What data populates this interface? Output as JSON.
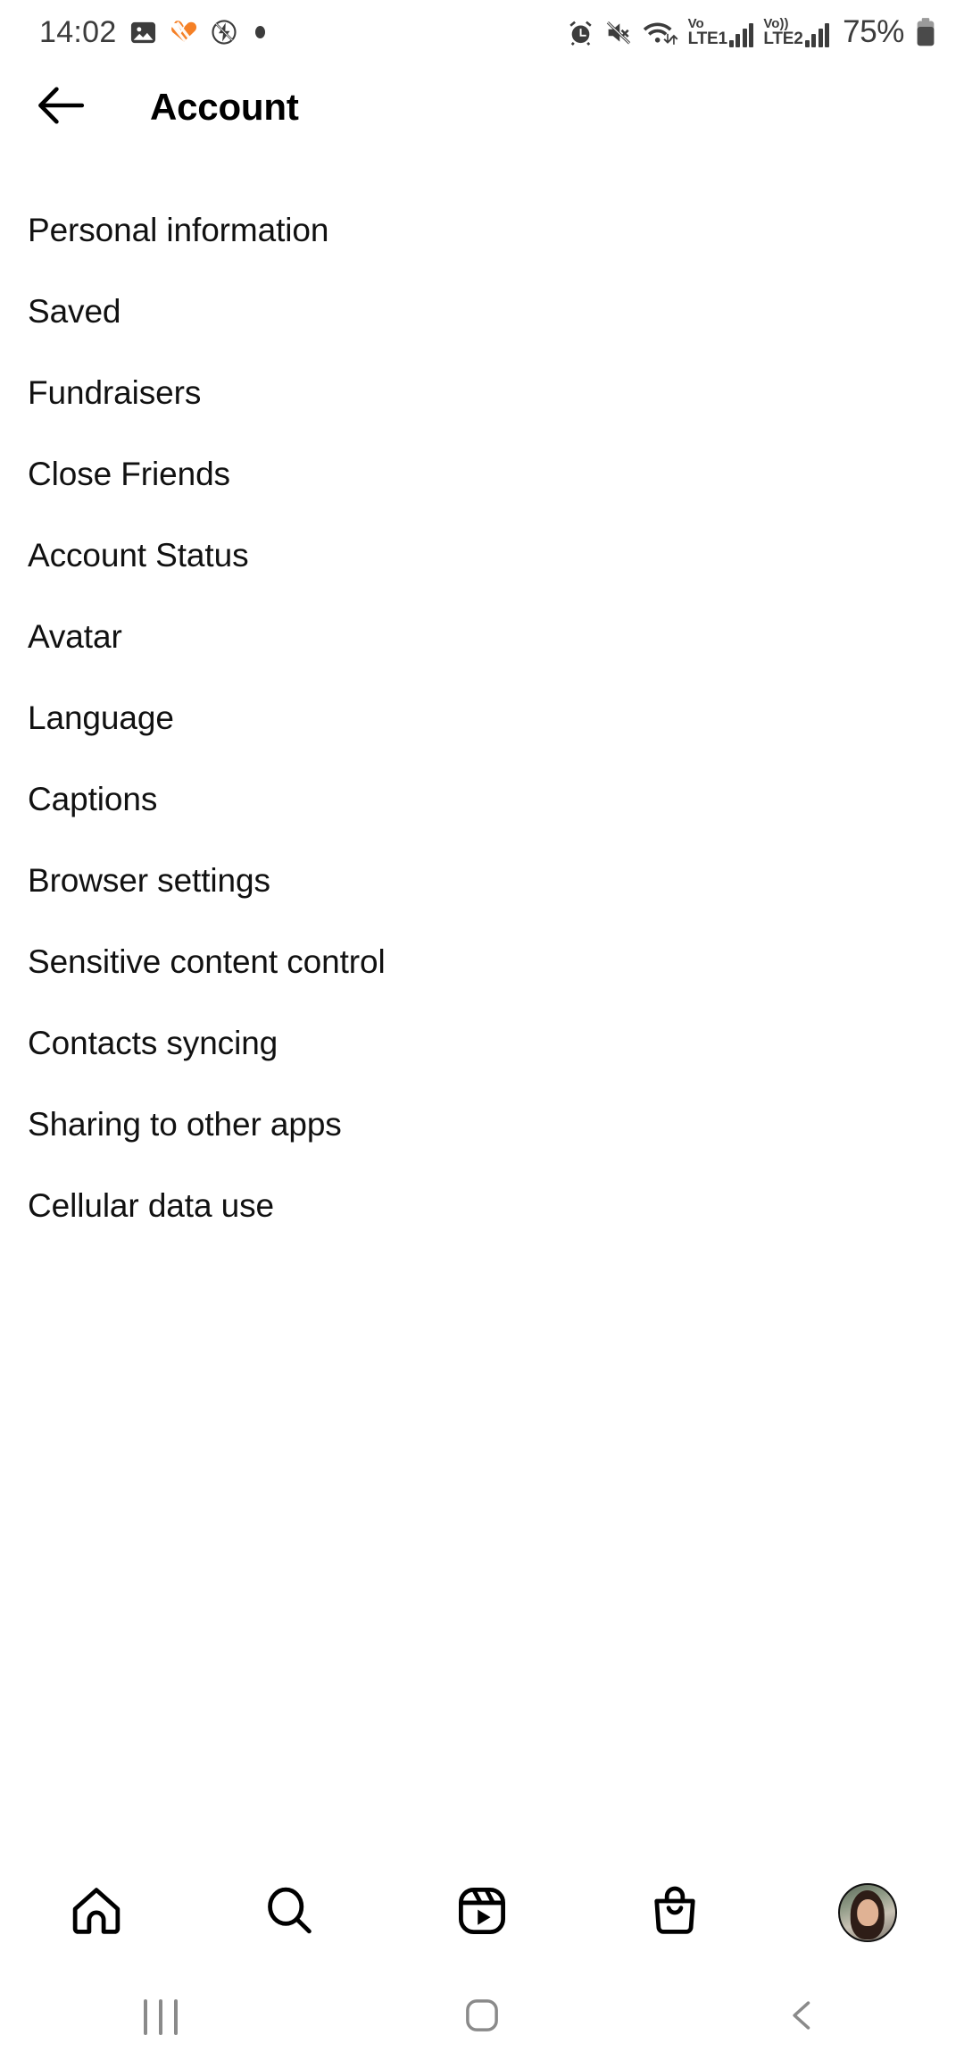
{
  "status_bar": {
    "time": "14:02",
    "left_icons": [
      "image-icon",
      "heart-logo-icon",
      "flash-off-icon",
      "dot-indicator-icon"
    ],
    "alarm_icon": "alarm-icon",
    "mute_icon": "volume-mute-icon",
    "wifi_icon": "wifi-data-icon",
    "sim1": {
      "vo_label": "Vo",
      "lte_label": "LTE1"
    },
    "sim2": {
      "vo_label": "Vo))",
      "lte_label": "LTE2"
    },
    "battery_percent": "75%",
    "battery_icon": "battery-icon",
    "accent_color": "#F58026",
    "icon_color": "#3c3c3c"
  },
  "header": {
    "back_icon": "back-arrow-icon",
    "title": "Account"
  },
  "menu": {
    "items": [
      {
        "label": "Personal information"
      },
      {
        "label": "Saved"
      },
      {
        "label": "Fundraisers"
      },
      {
        "label": "Close Friends"
      },
      {
        "label": "Account Status"
      },
      {
        "label": "Avatar"
      },
      {
        "label": "Language"
      },
      {
        "label": "Captions"
      },
      {
        "label": "Browser settings"
      },
      {
        "label": "Sensitive content control"
      },
      {
        "label": "Contacts syncing"
      },
      {
        "label": "Sharing to other apps"
      },
      {
        "label": "Cellular data use"
      }
    ]
  },
  "bottom_nav": {
    "items": [
      {
        "name": "home",
        "icon": "home-icon"
      },
      {
        "name": "search",
        "icon": "search-icon"
      },
      {
        "name": "reels",
        "icon": "reels-icon"
      },
      {
        "name": "shop",
        "icon": "shop-bag-icon"
      },
      {
        "name": "profile",
        "icon": "profile-avatar-icon"
      }
    ]
  },
  "android_nav": {
    "recents_icon": "recents-icon",
    "home_icon": "home-square-icon",
    "back_icon": "back-chevron-icon",
    "color": "#8a8a8a"
  }
}
